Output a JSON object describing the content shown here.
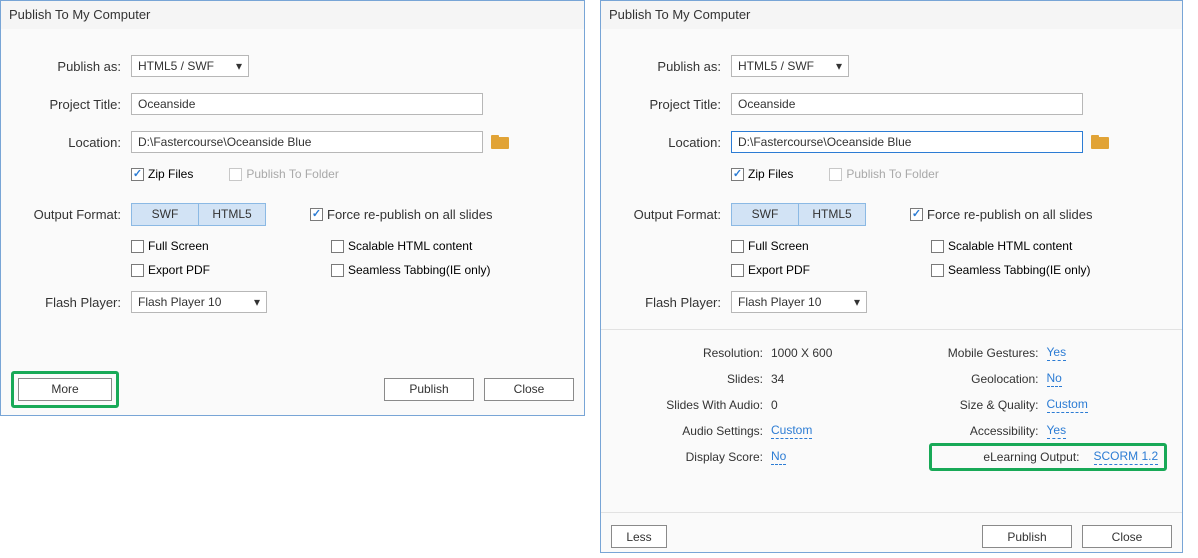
{
  "leftDialog": {
    "title": "Publish To My Computer",
    "publishAs": {
      "label": "Publish as:",
      "value": "HTML5 / SWF"
    },
    "projectTitle": {
      "label": "Project Title:",
      "value": "Oceanside"
    },
    "location": {
      "label": "Location:",
      "value": "D:\\Fastercourse\\Oceanside Blue"
    },
    "zipFiles": "Zip Files",
    "publishToFolder": "Publish To Folder",
    "outputFormat": {
      "label": "Output Format:",
      "swf": "SWF",
      "html5": "HTML5"
    },
    "forceRepublish": "Force re-publish on all slides",
    "fullScreen": "Full Screen",
    "scalable": "Scalable HTML content",
    "exportPDF": "Export PDF",
    "seamless": "Seamless Tabbing(IE only)",
    "flashPlayer": {
      "label": "Flash Player:",
      "value": "Flash Player 10"
    },
    "moreBtn": "More",
    "publishBtn": "Publish",
    "closeBtn": "Close"
  },
  "rightDialog": {
    "title": "Publish To My Computer",
    "publishAs": {
      "label": "Publish as:",
      "value": "HTML5 / SWF"
    },
    "projectTitle": {
      "label": "Project Title:",
      "value": "Oceanside"
    },
    "location": {
      "label": "Location:",
      "value": "D:\\Fastercourse\\Oceanside Blue"
    },
    "zipFiles": "Zip Files",
    "publishToFolder": "Publish To Folder",
    "outputFormat": {
      "label": "Output Format:",
      "swf": "SWF",
      "html5": "HTML5"
    },
    "forceRepublish": "Force re-publish on all slides",
    "fullScreen": "Full Screen",
    "scalable": "Scalable HTML content",
    "exportPDF": "Export PDF",
    "seamless": "Seamless Tabbing(IE only)",
    "flashPlayer": {
      "label": "Flash Player:",
      "value": "Flash Player 10"
    },
    "more": {
      "resolution": {
        "label": "Resolution:",
        "value": "1000 X 600"
      },
      "slides": {
        "label": "Slides:",
        "value": "34"
      },
      "slidesWithAudio": {
        "label": "Slides With Audio:",
        "value": "0"
      },
      "audioSettings": {
        "label": "Audio Settings:",
        "value": "Custom"
      },
      "displayScore": {
        "label": "Display Score:",
        "value": "No"
      },
      "mobileGestures": {
        "label": "Mobile Gestures:",
        "value": "Yes"
      },
      "geolocation": {
        "label": "Geolocation:",
        "value": "No"
      },
      "sizeQuality": {
        "label": "Size & Quality:",
        "value": "Custom"
      },
      "accessibility": {
        "label": "Accessibility:",
        "value": "Yes"
      },
      "elearning": {
        "label": "eLearning Output:",
        "value": "SCORM 1.2"
      }
    },
    "lessBtn": "Less",
    "publishBtn": "Publish",
    "closeBtn": "Close"
  }
}
